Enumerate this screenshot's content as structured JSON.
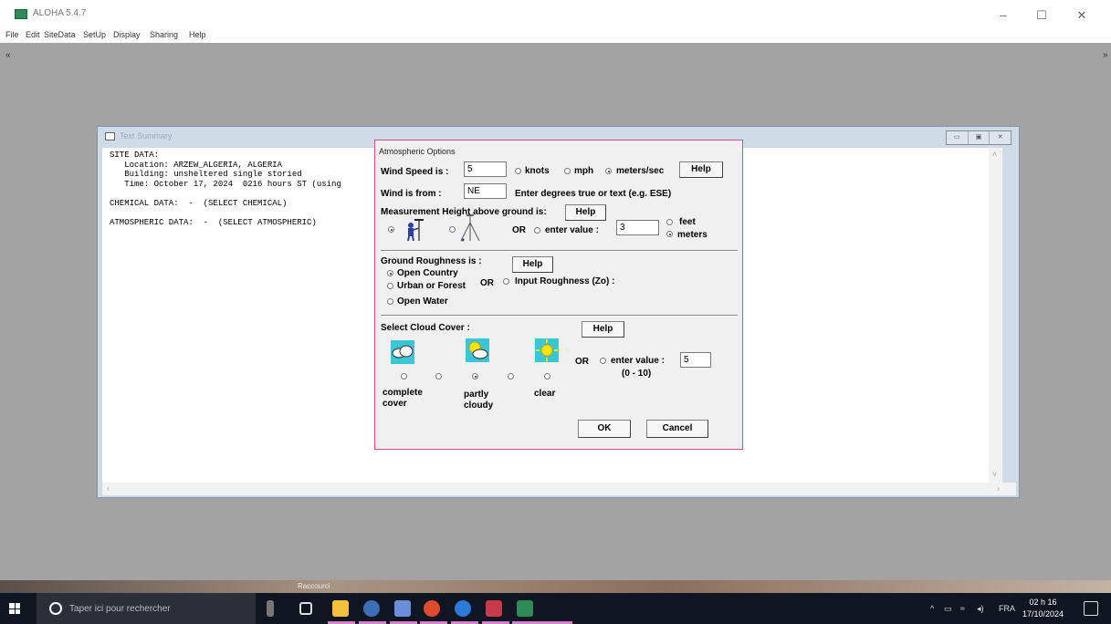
{
  "app": {
    "title": "ALOHA 5.4.7",
    "menu": [
      "File",
      "Edit",
      "SiteData",
      "SetUp",
      "Display",
      "Sharing",
      "Help"
    ]
  },
  "summary": {
    "title": "Text Summary",
    "lines": [
      "SITE DATA:",
      "   Location: ARZEW_ALGERIA, ALGERIA",
      "   Building: unsheltered single storied",
      "   Time: October 17, 2024  0216 hours ST (using",
      "",
      "CHEMICAL DATA:  -  (SELECT CHEMICAL)",
      "",
      "ATMOSPHERIC DATA:  -  (SELECT ATMOSPHERIC)"
    ]
  },
  "dialog": {
    "title": "Atmospheric Options",
    "wind_speed_label": "Wind Speed is :",
    "wind_speed_value": "5",
    "unit_knots": "knots",
    "unit_mph": "mph",
    "unit_ms": "meters/sec",
    "help": "Help",
    "wind_from_label": "Wind is from   :",
    "wind_from_value": "NE",
    "wind_from_hint": "Enter degrees true or text (e.g. ESE)",
    "height_label": "Measurement Height above ground is:",
    "or": "OR",
    "enter_value": "enter value :",
    "height_value": "3",
    "feet": "feet",
    "meters": "meters",
    "roughness_label": "Ground Roughness is :",
    "open_country": "Open Country",
    "urban_forest": "Urban or Forest",
    "open_water": "Open Water",
    "input_roughness": "Input Roughness (Zo) :",
    "cloud_label": "Select Cloud Cover :",
    "cloud_value": "5",
    "cloud_range": "(0 - 10)",
    "complete": "complete",
    "cover": "cover",
    "partly": "partly",
    "cloudy": "cloudy",
    "clear": "clear",
    "ok": "OK",
    "cancel": "Cancel"
  },
  "taskbar": {
    "search_placeholder": "Taper ici pour rechercher",
    "lang": "FRA",
    "time": "02 h 16",
    "date": "17/10/2024",
    "shortcut_label": "Raccourci"
  }
}
